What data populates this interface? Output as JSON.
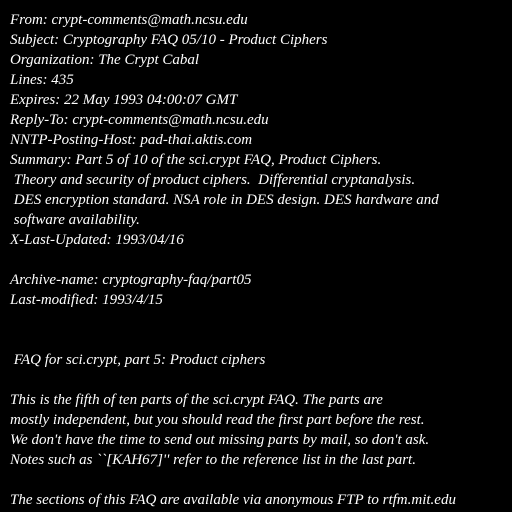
{
  "message": {
    "lines": [
      "From: crypt-comments@math.ncsu.edu",
      "Subject: Cryptography FAQ 05/10 - Product Ciphers",
      "Organization: The Crypt Cabal",
      "Lines: 435",
      "Expires: 22 May 1993 04:00:07 GMT",
      "Reply-To: crypt-comments@math.ncsu.edu",
      "NNTP-Posting-Host: pad-thai.aktis.com",
      "Summary: Part 5 of 10 of the sci.crypt FAQ, Product Ciphers.",
      " Theory and security of product ciphers.  Differential cryptanalysis.",
      " DES encryption standard. NSA role in DES design. DES hardware and",
      " software availability.",
      "X-Last-Updated: 1993/04/16",
      "",
      "Archive-name: cryptography-faq/part05",
      "Last-modified: 1993/4/15",
      "",
      "",
      " FAQ for sci.crypt, part 5: Product ciphers",
      "",
      "This is the fifth of ten parts of the sci.crypt FAQ. The parts are",
      "mostly independent, but you should read the first part before the rest.",
      "We don't have the time to send out missing parts by mail, so don't ask.",
      "Notes such as ``[KAH67]'' refer to the reference list in the last part.",
      "",
      "The sections of this FAQ are available via anonymous FTP to rtfm.mit.edu"
    ]
  },
  "colors": {
    "background": "#000000",
    "text": "#ffffff"
  }
}
